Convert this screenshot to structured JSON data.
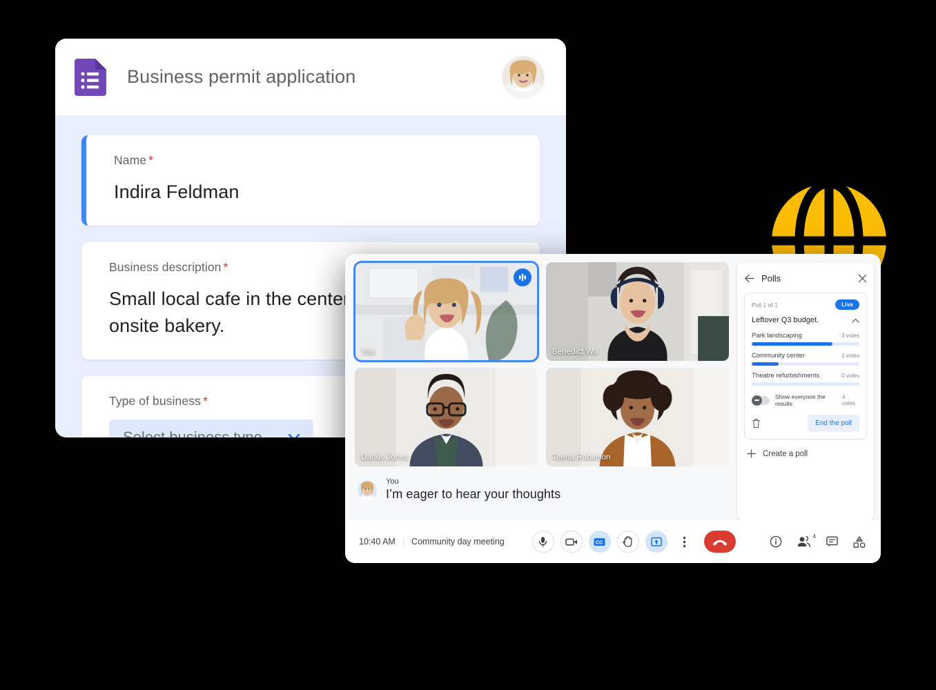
{
  "background": {
    "color": "#000000"
  },
  "decoration": {
    "globe_icon": "globe-grid-icon",
    "globe_color": "#fbbc04"
  },
  "forms": {
    "app_icon": "google-forms-icon",
    "app_icon_color": "#7248b9",
    "title": "Business permit application",
    "avatar": "user-avatar",
    "fields": [
      {
        "label": "Name",
        "required_marker": "*",
        "value": "Indira Feldman",
        "type": "text",
        "active": true
      },
      {
        "label": "Business description",
        "required_marker": "*",
        "value": "Small local cafe in the center of town with an onsite bakery.",
        "type": "textarea",
        "active": false
      },
      {
        "label": "Type of business",
        "required_marker": "*",
        "value": "",
        "placeholder": "Select business type",
        "type": "select",
        "active": false
      }
    ]
  },
  "meet": {
    "tiles": [
      {
        "name": "You",
        "speaking": true,
        "mic_indicator": "audio-level-icon"
      },
      {
        "name": "Benedict Wu",
        "speaking": false,
        "mic_indicator": ""
      },
      {
        "name": "Darius Jones",
        "speaking": false,
        "mic_indicator": ""
      },
      {
        "name": "Teena Robinson",
        "speaking": false,
        "mic_indicator": ""
      }
    ],
    "caption": {
      "speaker": "You",
      "text": "I’m eager to hear your thoughts",
      "avatar": "caption-avatar"
    },
    "bottom_bar": {
      "time": "10:40 AM",
      "separator": "|",
      "meeting_name": "Community day meeting",
      "controls": [
        {
          "name": "microphone-button",
          "icon": "microphone-icon",
          "active": false
        },
        {
          "name": "camera-button",
          "icon": "video-camera-off-icon",
          "active": false
        },
        {
          "name": "captions-button",
          "icon": "closed-captions-icon",
          "active": true
        },
        {
          "name": "raise-hand-button",
          "icon": "raised-hand-icon",
          "active": false
        },
        {
          "name": "present-button",
          "icon": "present-screen-icon",
          "active": true
        },
        {
          "name": "more-options-button",
          "icon": "more-vertical-icon",
          "active": false
        }
      ],
      "end_call": {
        "name": "end-call-button",
        "icon": "phone-hangup-icon",
        "color": "#d93b30"
      },
      "right_controls": [
        {
          "name": "meeting-details-button",
          "icon": "info-icon",
          "badge": ""
        },
        {
          "name": "participants-button",
          "icon": "people-icon",
          "badge": "4"
        },
        {
          "name": "chat-button",
          "icon": "chat-bubble-icon",
          "badge": ""
        },
        {
          "name": "activities-button",
          "icon": "activities-shapes-icon",
          "badge": ""
        }
      ]
    }
  },
  "polls": {
    "back_icon": "arrow-back-icon",
    "title": "Polls",
    "close_icon": "close-icon",
    "poll": {
      "index_label": "Poll 1 of 1",
      "status_badge": "Live",
      "question": "Leftover Q3 budget.",
      "collapse_icon": "chevron-up-icon",
      "options": [
        {
          "label": "Park landscaping",
          "votes": "3 votes",
          "percent": 75
        },
        {
          "label": "Community center",
          "votes": "1 votes",
          "percent": 25
        },
        {
          "label": "Theatre refurbishments",
          "votes": "0 votes",
          "percent": 0
        }
      ],
      "show_results_toggle": {
        "label": "Show everyone the results",
        "on": false
      },
      "total_votes": "4 votes",
      "delete_icon": "trash-icon",
      "end_poll_label": "End the poll"
    },
    "create_poll": {
      "icon": "plus-icon",
      "label": "Create a poll"
    }
  },
  "colors": {
    "accent_blue": "#1a73e8",
    "forms_purple": "#7248b9",
    "required_red": "#d93025",
    "globe_yellow": "#fbbc04",
    "form_bg": "#e8eefc"
  }
}
